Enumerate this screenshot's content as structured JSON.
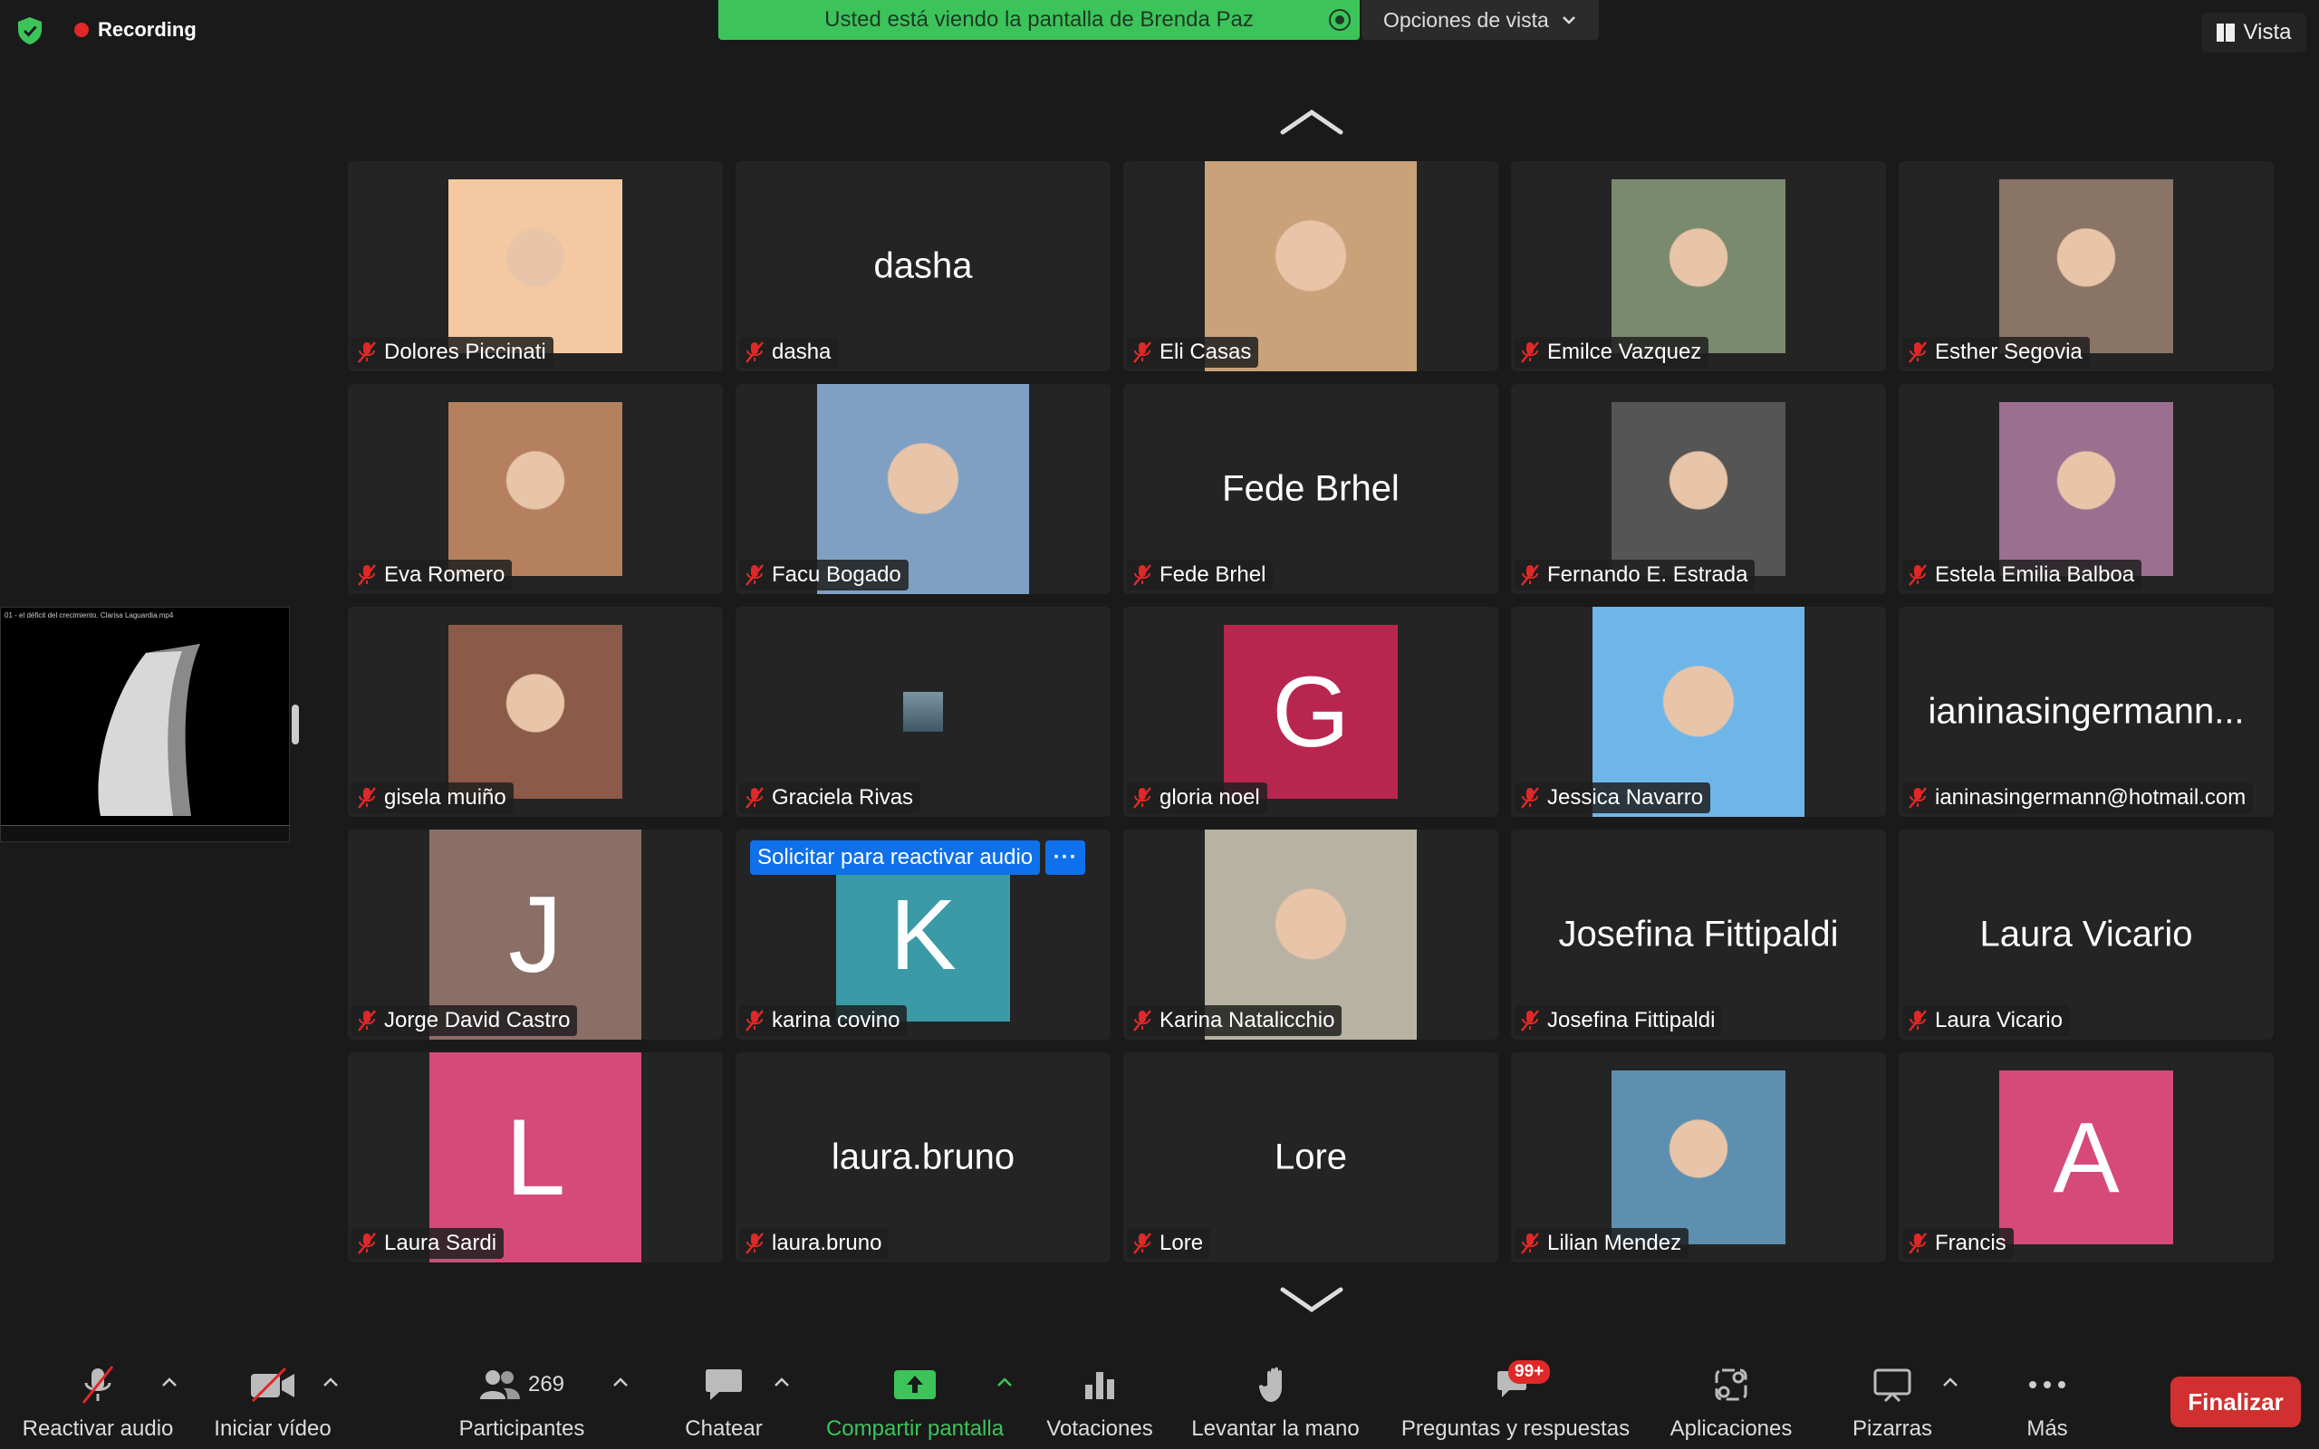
{
  "top": {
    "recording": "Recording",
    "share_banner": "Usted está viendo la pantalla de Brenda Paz",
    "view_options": "Opciones de vista",
    "view": "Vista"
  },
  "shared_screen": {
    "title": "01 - el déficit del crecimiento. Clarisa Laguardia.mp4"
  },
  "unmute_request": "Solicitar para reactivar audio",
  "more": "···",
  "tiles": [
    {
      "name": "Dolores Piccinati",
      "display": "",
      "kind": "photo",
      "avatar_color": "#f4c9a2"
    },
    {
      "name": "dasha",
      "display": "dasha",
      "kind": "name",
      "avatar_color": ""
    },
    {
      "name": "Eli Casas",
      "display": "",
      "kind": "photo",
      "avatar_color": "#c9a27a"
    },
    {
      "name": "Emilce Vazquez",
      "display": "",
      "kind": "photo",
      "avatar_color": "#7a8a6f"
    },
    {
      "name": "Esther Segovia",
      "display": "",
      "kind": "photo",
      "avatar_color": "#8a7466"
    },
    {
      "name": "Eva Romero",
      "display": "",
      "kind": "photo",
      "avatar_color": "#b5805e"
    },
    {
      "name": "Facu Bogado",
      "display": "",
      "kind": "photo",
      "avatar_color": "#7fa0c2"
    },
    {
      "name": "Fede Brhel",
      "display": "Fede Brhel",
      "kind": "name",
      "avatar_color": ""
    },
    {
      "name": "Fernando E. Estrada",
      "display": "",
      "kind": "photo",
      "avatar_color": "#555555"
    },
    {
      "name": "Estela Emilia Balboa",
      "display": "",
      "kind": "photo",
      "avatar_color": "#9b6f8f"
    },
    {
      "name": "gisela muiño",
      "display": "",
      "kind": "photo",
      "avatar_color": "#8b5a48"
    },
    {
      "name": "Graciela Rivas",
      "display": "",
      "kind": "tiny",
      "avatar_color": ""
    },
    {
      "name": "gloria noel",
      "display": "G",
      "kind": "avatar",
      "avatar_color": "#b8264f"
    },
    {
      "name": "Jessica Navarro",
      "display": "",
      "kind": "photo",
      "avatar_color": "#6fb6e8"
    },
    {
      "name": "ianinasingermann@hotmail.com",
      "display": "ianinasingermann...",
      "kind": "name",
      "avatar_color": ""
    },
    {
      "name": "Jorge David Castro",
      "display": "J",
      "kind": "avatar",
      "avatar_color": "#8b6e66"
    },
    {
      "name": "karina covino",
      "display": "K",
      "kind": "avatar",
      "avatar_color": "#3a9aa6"
    },
    {
      "name": "Karina Natalicchio",
      "display": "",
      "kind": "photo",
      "avatar_color": "#b8b2a2"
    },
    {
      "name": "Josefina Fittipaldi",
      "display": "Josefina Fittipaldi",
      "kind": "name",
      "avatar_color": ""
    },
    {
      "name": "Laura Vicario",
      "display": "Laura Vicario",
      "kind": "name",
      "avatar_color": ""
    },
    {
      "name": "Laura Sardi",
      "display": "L",
      "kind": "avatar",
      "avatar_color": "#d54a78"
    },
    {
      "name": "laura.bruno",
      "display": "laura.bruno",
      "kind": "name",
      "avatar_color": ""
    },
    {
      "name": "Lore",
      "display": "Lore",
      "kind": "name",
      "avatar_color": ""
    },
    {
      "name": "Lilian Mendez",
      "display": "",
      "kind": "photo",
      "avatar_color": "#5d8fb0"
    },
    {
      "name": "Francis",
      "display": "A",
      "kind": "avatar",
      "avatar_color": "#d54a78"
    }
  ],
  "toolbar": {
    "unmute": "Reactivar audio",
    "start_video": "Iniciar vídeo",
    "participants": "Participantes",
    "participants_count": "269",
    "chat": "Chatear",
    "share": "Compartir pantalla",
    "polls": "Votaciones",
    "raise_hand": "Levantar la mano",
    "qa": "Preguntas y respuestas",
    "qa_badge": "99+",
    "apps": "Aplicaciones",
    "whiteboards": "Pizarras",
    "more": "Más",
    "end": "Finalizar"
  },
  "colors": {
    "share_green": "#3cc45b",
    "end_red": "#d13030",
    "mute_red": "#e02828",
    "blue": "#0e71eb"
  }
}
